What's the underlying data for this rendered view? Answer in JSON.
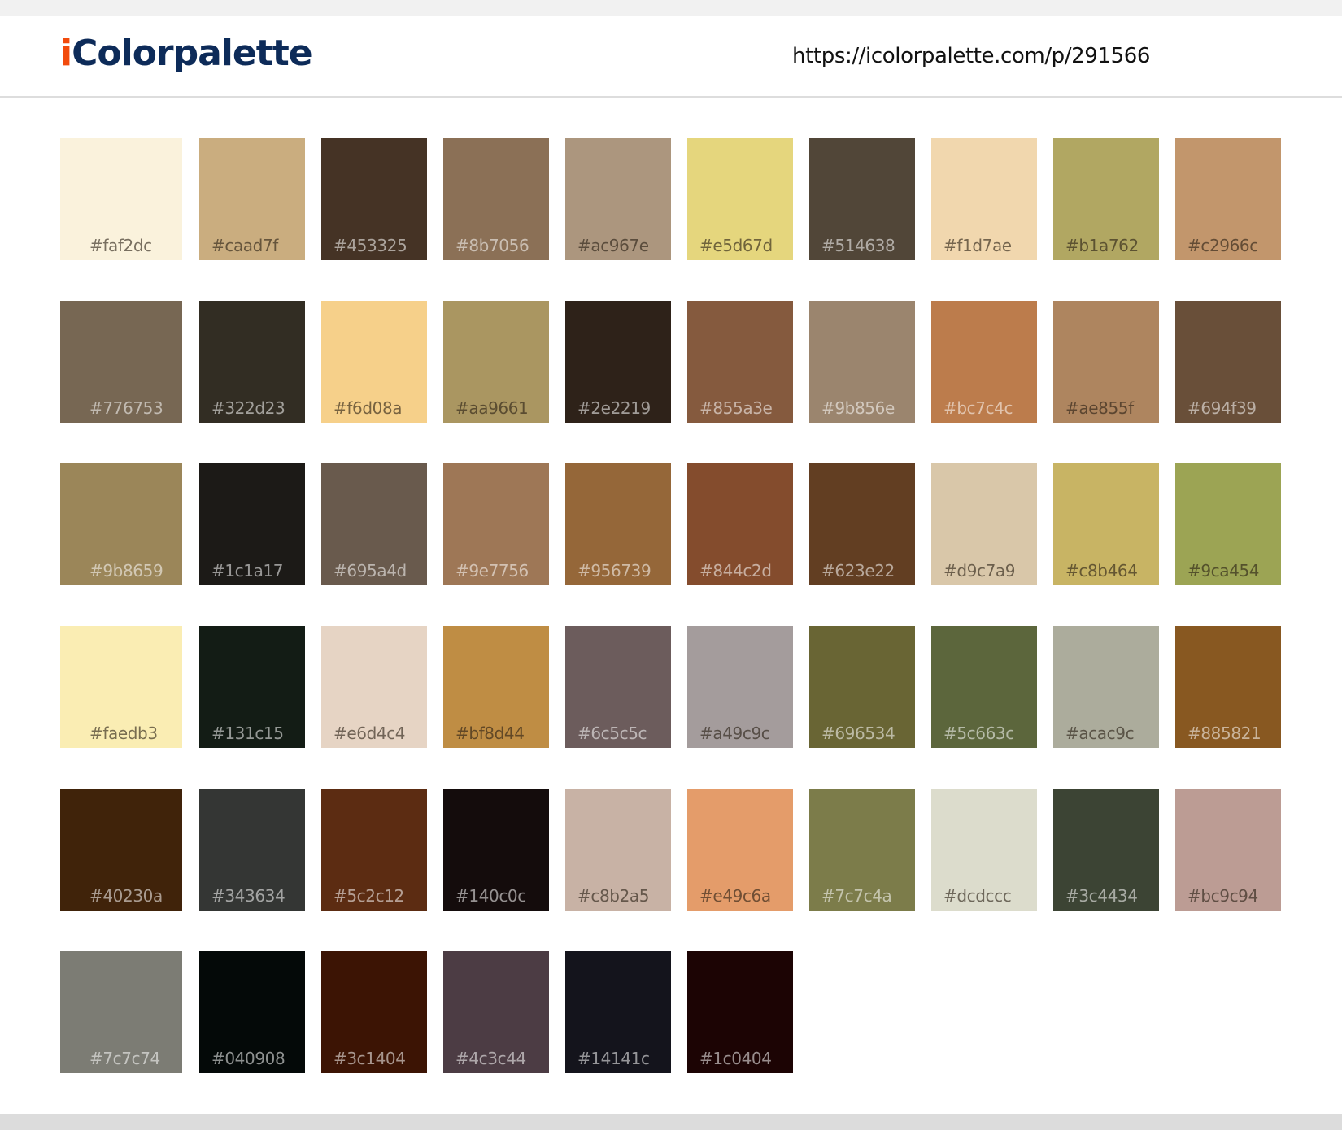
{
  "header": {
    "logo_i": "i",
    "logo_rest": "Colorpalette",
    "url": "https://icolorpalette.com/p/291566"
  },
  "colors": {
    "logo_i": "#f24b0d",
    "logo_text": "#0d2b59",
    "page_background": "#f1f1f1",
    "card_background": "#ffffff"
  },
  "swatches": [
    "#faf2dc",
    "#caad7f",
    "#453325",
    "#8b7056",
    "#ac967e",
    "#e5d67d",
    "#514638",
    "#f1d7ae",
    "#b1a762",
    "#c2966c",
    "#776753",
    "#322d23",
    "#f6d08a",
    "#aa9661",
    "#2e2219",
    "#855a3e",
    "#9b856e",
    "#bc7c4c",
    "#ae855f",
    "#694f39",
    "#9b8659",
    "#1c1a17",
    "#695a4d",
    "#9e7756",
    "#956739",
    "#844c2d",
    "#623e22",
    "#d9c7a9",
    "#c8b464",
    "#9ca454",
    "#faedb3",
    "#131c15",
    "#e6d4c4",
    "#bf8d44",
    "#6c5c5c",
    "#a49c9c",
    "#696534",
    "#5c663c",
    "#acac9c",
    "#885821",
    "#40230a",
    "#343634",
    "#5c2c12",
    "#140c0c",
    "#c8b2a5",
    "#e49c6a",
    "#7c7c4a",
    "#dcdccc",
    "#3c4434",
    "#bc9c94",
    "#7c7c74",
    "#040908",
    "#3c1404",
    "#4c3c44",
    "#14141c",
    "#1c0404"
  ]
}
